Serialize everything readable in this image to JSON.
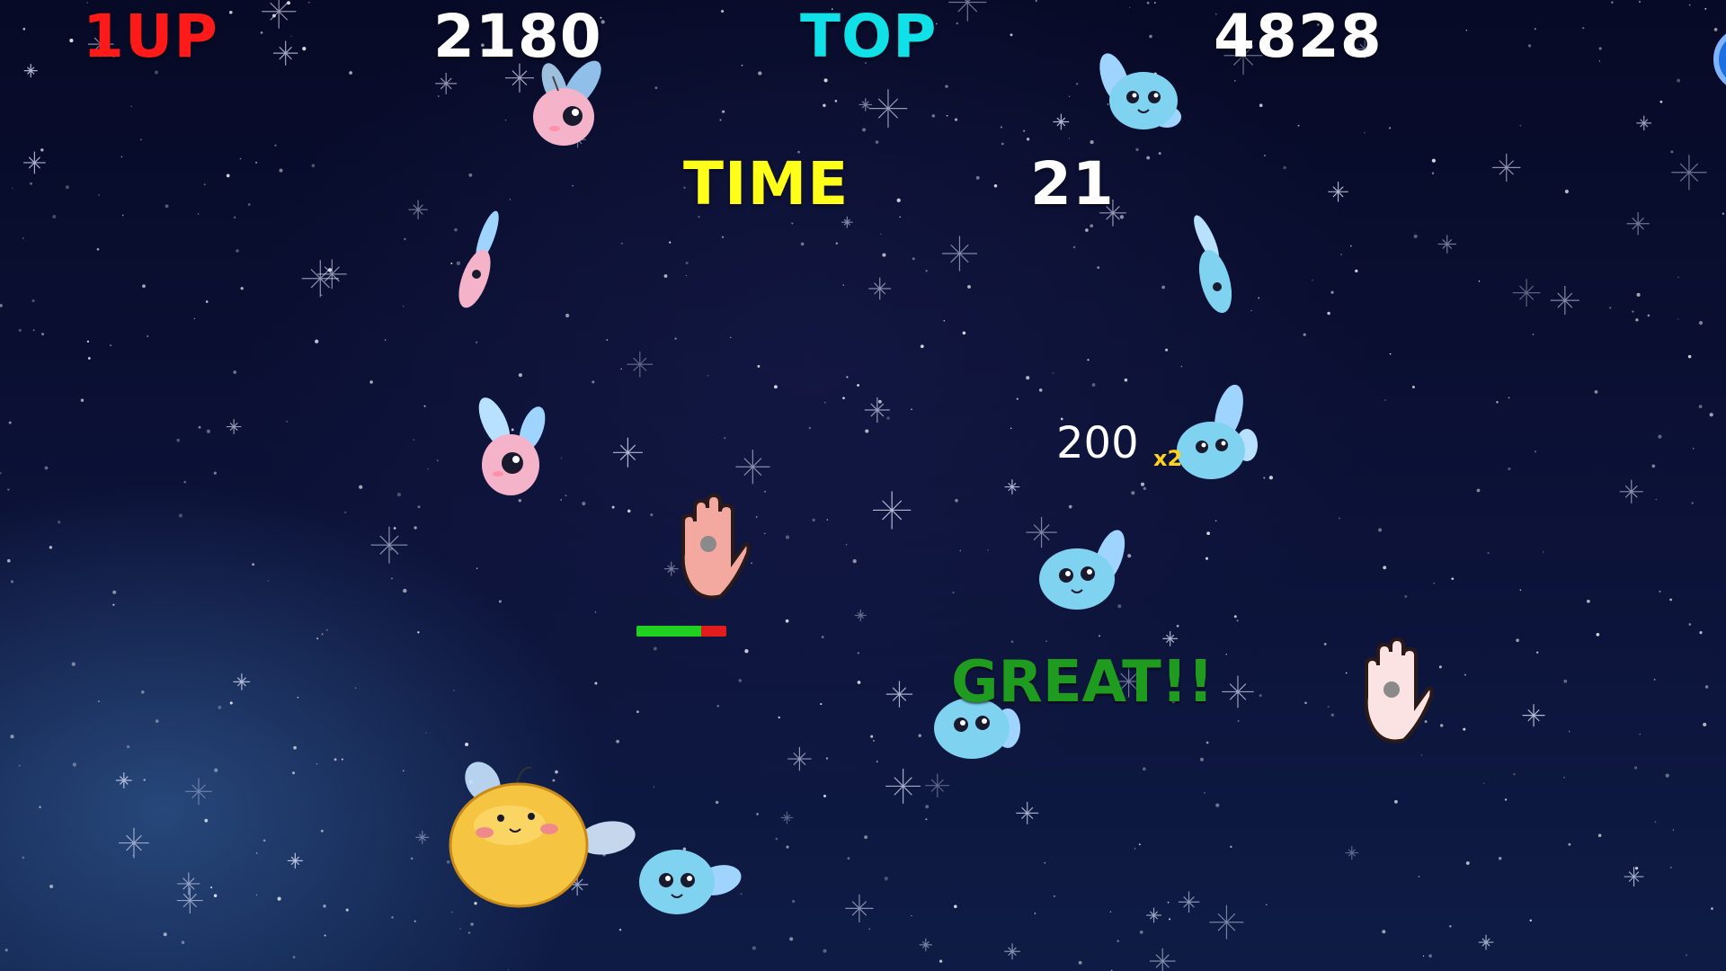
{
  "hud": {
    "player_label": "1UP",
    "player_score": "2180",
    "top_label": "TOP",
    "top_score": "4828",
    "time_label": "TIME",
    "time_value": "21"
  },
  "popups": {
    "points": "200",
    "multiplier": "x2",
    "rating": "GREAT!!"
  },
  "health_bar": {
    "fill_fraction": 0.72
  },
  "colors": {
    "player_label": "#ff1a1a",
    "top_label": "#10e0e8",
    "time_label": "#ffff1a",
    "values": "#ffffff",
    "rating": "#1f9b1f"
  },
  "sprites": [
    "pink-fairy-sprite",
    "blue-fairy-sprite",
    "yellow-bee-sprite",
    "hand-cursor-sprite"
  ]
}
